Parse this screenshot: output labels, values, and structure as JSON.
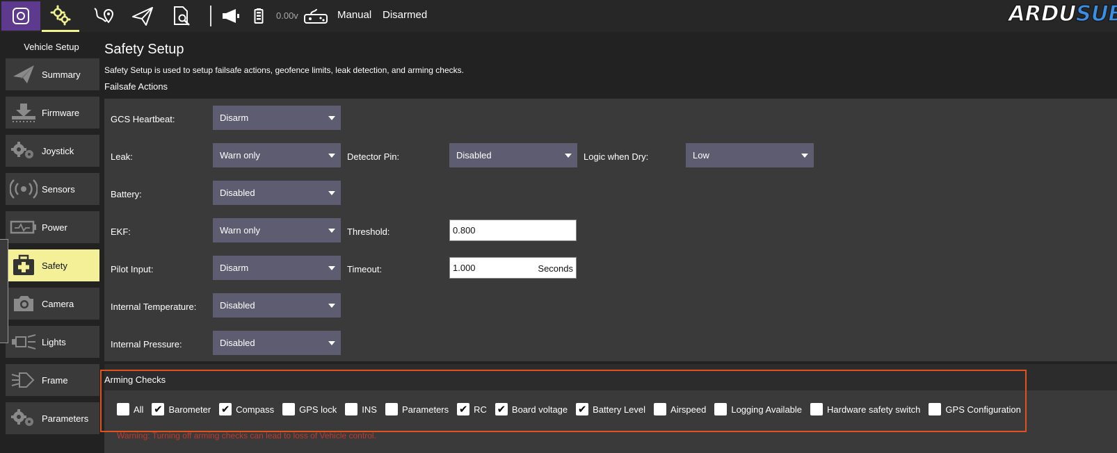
{
  "toolbar": {
    "battery_voltage": "0.00v",
    "flight_mode": "Manual",
    "arm_status": "Disarmed",
    "brand_part1": "ARDU",
    "brand_part2": "SUB",
    "icons": [
      "app-logo-icon",
      "vehicle-setup-gears-icon",
      "plan-route-icon",
      "fly-paper-plane-icon",
      "analyze-document-icon",
      "megaphone-icon",
      "battery-icon",
      "joystick-icon"
    ]
  },
  "sidebar": {
    "title": "Vehicle Setup",
    "items": [
      {
        "label": "Summary",
        "icon": "paper-plane-icon"
      },
      {
        "label": "Firmware",
        "icon": "download-icon"
      },
      {
        "label": "Joystick",
        "icon": "gears-icon"
      },
      {
        "label": "Sensors",
        "icon": "radio-signal-icon"
      },
      {
        "label": "Power",
        "icon": "battery-pulse-icon"
      },
      {
        "label": "Safety",
        "icon": "first-aid-kit-icon",
        "active": true
      },
      {
        "label": "Camera",
        "icon": "camera-icon"
      },
      {
        "label": "Lights",
        "icon": "lights-icon"
      },
      {
        "label": "Frame",
        "icon": "frame-icon"
      },
      {
        "label": "Parameters",
        "icon": "gears-icon"
      }
    ]
  },
  "main": {
    "title": "Safety Setup",
    "description": "Safety Setup is used to setup failsafe actions, geofence limits, leak detection, and arming checks.",
    "failsafe_title": "Failsafe Actions",
    "failsafe": {
      "gcs_heartbeat": {
        "label": "GCS Heartbeat:",
        "value": "Disarm"
      },
      "leak": {
        "label": "Leak:",
        "value": "Warn only"
      },
      "detector_pin": {
        "label": "Detector Pin:",
        "value": "Disabled"
      },
      "logic_when_dry": {
        "label": "Logic when Dry:",
        "value": "Low"
      },
      "battery": {
        "label": "Battery:",
        "value": "Disabled"
      },
      "ekf": {
        "label": "EKF:",
        "value": "Warn only"
      },
      "ekf_threshold": {
        "label": "Threshold:",
        "value": "0.800"
      },
      "pilot_input": {
        "label": "Pilot Input:",
        "value": "Disarm"
      },
      "pilot_timeout": {
        "label": "Timeout:",
        "value": "1.000",
        "unit": "Seconds"
      },
      "internal_temperature": {
        "label": "Internal Temperature:",
        "value": "Disabled"
      },
      "internal_pressure": {
        "label": "Internal Pressure:",
        "value": "Disabled"
      }
    },
    "arming": {
      "title": "Arming Checks",
      "checks": [
        {
          "label": "All",
          "checked": false
        },
        {
          "label": "Barometer",
          "checked": true
        },
        {
          "label": "Compass",
          "checked": true
        },
        {
          "label": "GPS lock",
          "checked": false
        },
        {
          "label": "INS",
          "checked": false
        },
        {
          "label": "Parameters",
          "checked": false
        },
        {
          "label": "RC",
          "checked": true
        },
        {
          "label": "Board voltage",
          "checked": true
        },
        {
          "label": "Battery Level",
          "checked": true
        },
        {
          "label": "Airspeed",
          "checked": false
        },
        {
          "label": "Logging Available",
          "checked": false
        },
        {
          "label": "Hardware safety switch",
          "checked": false
        },
        {
          "label": "GPS Configuration",
          "checked": false
        }
      ],
      "warning": "Warning: Turning off arming checks can lead to loss of Vehicle control."
    }
  },
  "colors": {
    "accent": "#f4f097",
    "logo_bg": "#5d3a8e",
    "combo_bg": "#5e5c70",
    "warning": "#c0392b",
    "highlight": "#e0531f"
  }
}
